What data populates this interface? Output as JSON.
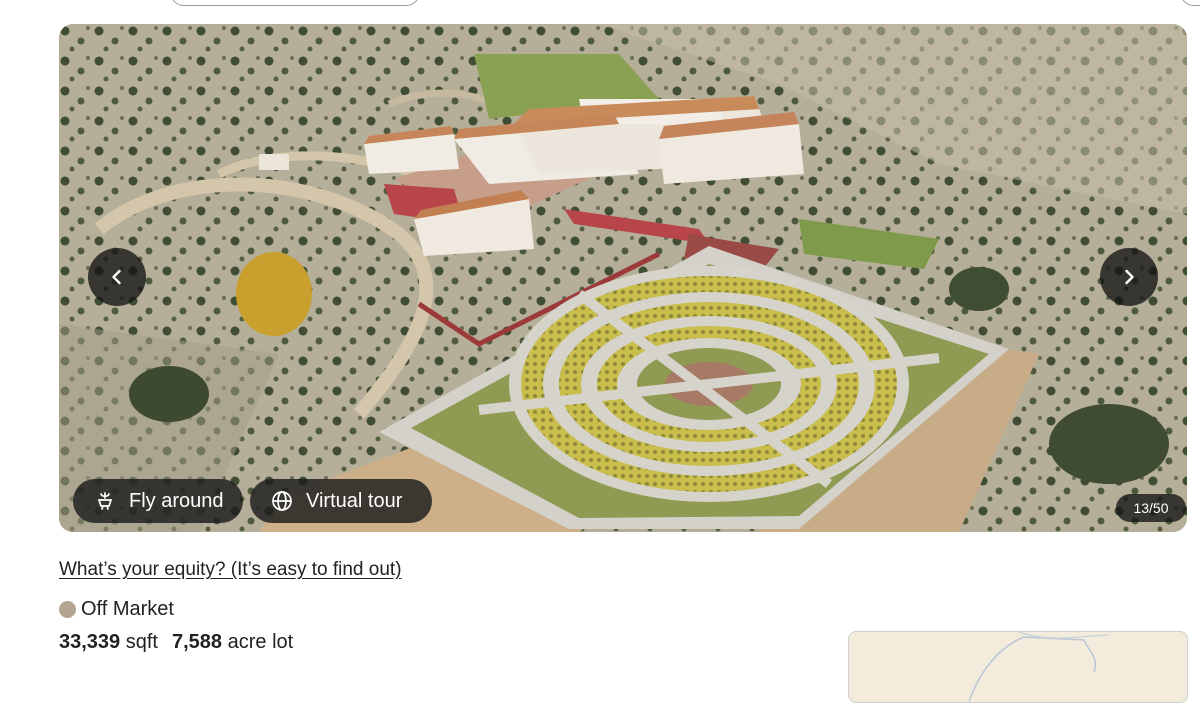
{
  "gallery": {
    "counter": "13/50",
    "fly_around_label": "Fly around",
    "virtual_tour_label": "Virtual tour"
  },
  "listing": {
    "equity_link": "What’s your equity? (It’s easy to find out)",
    "status": "Off Market",
    "status_color": "#b3a592",
    "sqft_value": "33,339",
    "sqft_unit": "sqft",
    "lot_value": "7,588",
    "lot_unit": "acre lot"
  },
  "icons": {
    "prev": "chevron-left-icon",
    "next": "chevron-right-icon",
    "fly": "drone-icon",
    "tour": "globe-icon"
  }
}
